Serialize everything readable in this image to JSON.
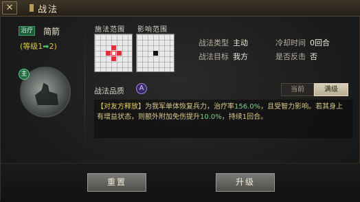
{
  "window": {
    "title": "战法",
    "close_label": "✕"
  },
  "skill": {
    "tag": "治疗",
    "name": "简箭",
    "level_prefix": "(等级1",
    "level_arrow": "➡",
    "level_suffix": "2)",
    "portrait_badge": "主"
  },
  "ranges": {
    "cast_label": "施法范围",
    "effect_label": "影响范围"
  },
  "info": {
    "type_key": "战法类型",
    "type_val": "主动",
    "cooldown_key": "冷却时间",
    "cooldown_val": "0回合",
    "target_key": "战法目标",
    "target_val": "我方",
    "counter_key": "是否反击",
    "counter_val": "否"
  },
  "quality": {
    "label": "战法品质",
    "grade": "A",
    "tab_current": "当前",
    "tab_max": "满级"
  },
  "description": {
    "bracket": "【对友方释放】",
    "part1": "为我军单体恢复兵力，治疗率",
    "rate": "156.0%",
    "part2": "，且受智力影响。若其身上有增益状态，则额外附加免伤提升",
    "bonus": "10.0%",
    "part3": "，持续1回合。"
  },
  "buttons": {
    "reset": "重置",
    "upgrade": "升级"
  },
  "colors": {
    "cast_fill": "#e0303a",
    "cast_center": "#ffffff",
    "effect_center": "#111111"
  }
}
